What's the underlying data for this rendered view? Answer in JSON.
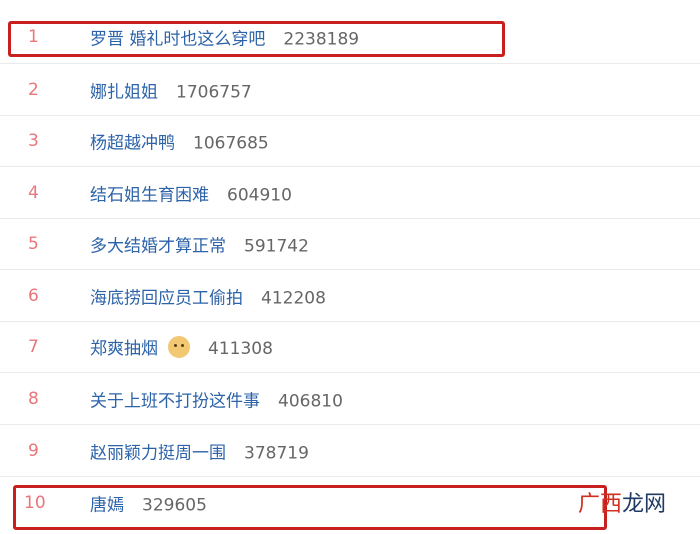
{
  "hot_search_list": [
    {
      "rank": "1",
      "title": "罗晋 婚礼时也这么穿吧",
      "count": "2238189"
    },
    {
      "rank": "2",
      "title": "娜扎姐姐",
      "count": "1706757"
    },
    {
      "rank": "3",
      "title": "杨超越冲鸭",
      "count": "1067685"
    },
    {
      "rank": "4",
      "title": "结石姐生育困难",
      "count": "604910"
    },
    {
      "rank": "5",
      "title": "多大结婚才算正常",
      "count": "591742"
    },
    {
      "rank": "6",
      "title": "海底捞回应员工偷拍",
      "count": "412208"
    },
    {
      "rank": "7",
      "title": "郑爽抽烟",
      "count": "411308",
      "emoji": "dog-face-emoji-icon"
    },
    {
      "rank": "8",
      "title": "关于上班不打扮这件事",
      "count": "406810"
    },
    {
      "rank": "9",
      "title": "赵丽颖力挺周一围",
      "count": "378719"
    },
    {
      "rank": "10",
      "title": "唐嫣",
      "count": "329605"
    }
  ],
  "watermark": {
    "part1": "广西",
    "part2": "龙网"
  },
  "colors": {
    "rank": "#e8767a",
    "title": "#2d63a8",
    "count": "#666666",
    "highlight": "#c8201e"
  }
}
